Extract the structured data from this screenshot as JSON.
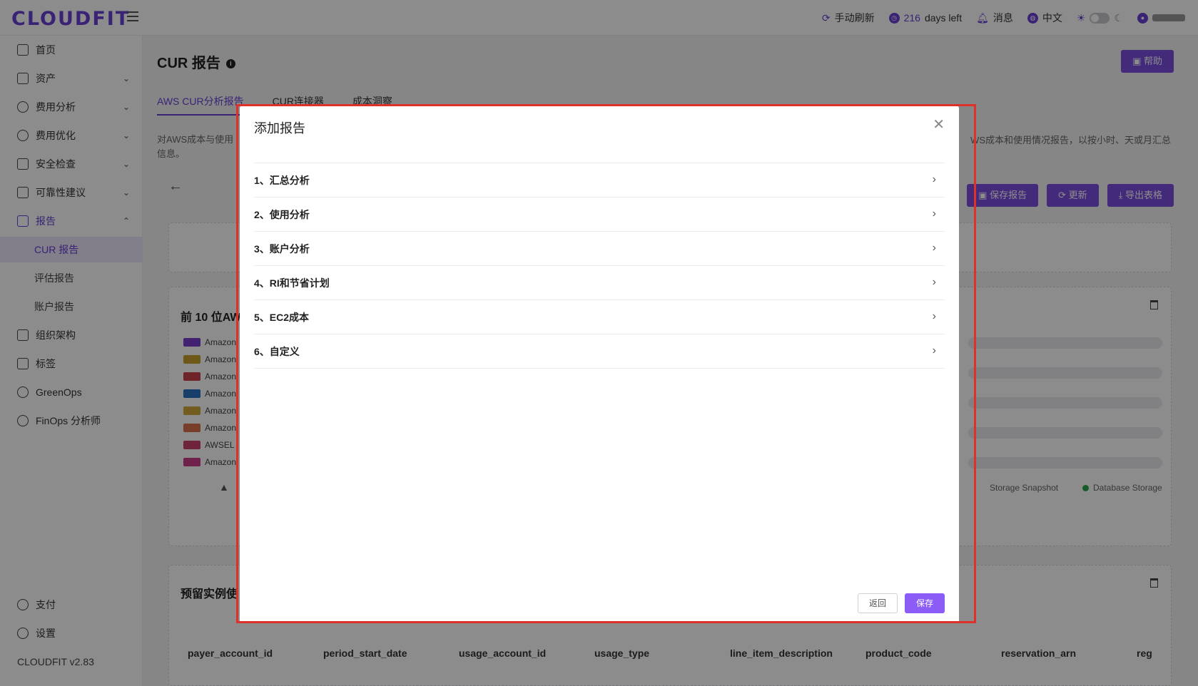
{
  "app": {
    "logo": "CLOUDFIT",
    "version": "CLOUDFIT v2.83"
  },
  "topbar": {
    "refresh": "手动刷新",
    "days_number": "216",
    "days_label": "days left",
    "messages": "消息",
    "language": "中文"
  },
  "sidebar": {
    "items": [
      {
        "label": "首页"
      },
      {
        "label": "资产"
      },
      {
        "label": "费用分析"
      },
      {
        "label": "费用优化"
      },
      {
        "label": "安全检查"
      },
      {
        "label": "可靠性建议"
      },
      {
        "label": "报告"
      },
      {
        "label": "组织架构"
      },
      {
        "label": "标签"
      },
      {
        "label": "GreenOps"
      },
      {
        "label": "FinOps 分析师"
      },
      {
        "label": "支付"
      },
      {
        "label": "设置"
      }
    ],
    "report_sub": [
      "CUR 报告",
      "评估报告",
      "账户报告"
    ]
  },
  "page": {
    "title": "CUR 报告",
    "help": "帮助",
    "tabs": [
      "AWS CUR分析报告",
      "CUR连接器",
      "成本洞察"
    ],
    "desc_left_1": "对AWS成本与使用",
    "desc_left_2": "信息。",
    "desc_right": "WS成本和使用情况报告，以按小时、天或月汇总",
    "actions": [
      "保存报告",
      "更新",
      "导出表格"
    ],
    "card1_title": "前 10 位AW",
    "card2_title": "预留实例使",
    "legend": [
      "Amazon",
      "Amazon",
      "Amazon",
      "Amazon",
      "Amazon",
      "Amazon",
      "AWSEL",
      "Amazon"
    ],
    "legend_bottom": [
      "Storage Snapshot",
      "Database Storage"
    ],
    "table_columns": [
      "payer_account_id",
      "period_start_date",
      "usage_account_id",
      "usage_type",
      "line_item_description",
      "product_code",
      "reservation_arn",
      "reg"
    ]
  },
  "modal": {
    "title": "添加报告",
    "items": [
      "1、汇总分析",
      "2、使用分析",
      "3、账户分析",
      "4、RI和节省计划",
      "5、EC2成本",
      "6、自定义"
    ],
    "back": "返回",
    "save": "保存"
  },
  "colors": {
    "accent": "#6b3fd6",
    "button": "#7c4ee0",
    "highlight": "#e0302a",
    "legend": [
      "#7b3fd0",
      "#c8a02a",
      "#c8434a",
      "#2a6fc4",
      "#d1a83a",
      "#d9714e",
      "#c8436a",
      "#c83f8a"
    ]
  }
}
